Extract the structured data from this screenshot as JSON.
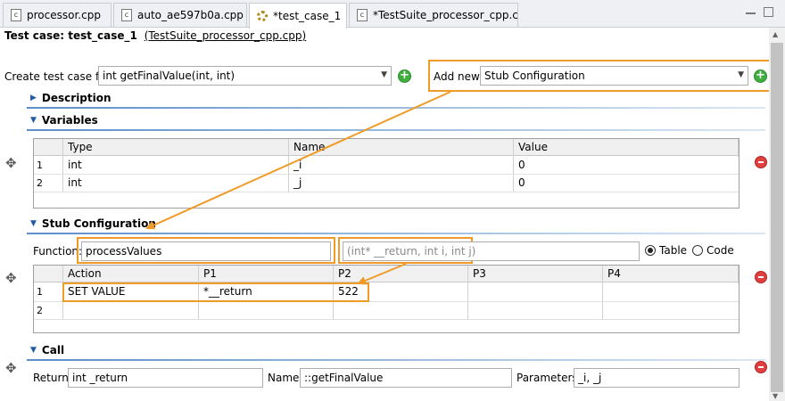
{
  "tabs": [
    {
      "label": "processor.cpp",
      "icon": "c-file-icon"
    },
    {
      "label": "auto_ae597b0a.cpp",
      "icon": "c-file-icon"
    },
    {
      "label": "*test_case_1",
      "icon": "gear-icon",
      "close": "×"
    },
    {
      "label": "*TestSuite_processor_cpp.cpp",
      "icon": "c-file-icon"
    }
  ],
  "file_icon_glyph": "c",
  "header": {
    "prefix": "Test case: test_case_1",
    "link": "(TestSuite_processor_cpp.cpp)"
  },
  "create": {
    "label": "Create test case for",
    "value": "int getFinalValue(int, int)"
  },
  "add_new": {
    "label": "Add new",
    "value": "Stub Configuration"
  },
  "sections": {
    "description": "Description",
    "variables": "Variables",
    "stub": "Stub Configuration",
    "call": "Call"
  },
  "variables": {
    "columns": [
      "Type",
      "Name",
      "Value"
    ],
    "rows": [
      {
        "num": "1",
        "type": "int",
        "name": "_i",
        "value": "0"
      },
      {
        "num": "2",
        "type": "int",
        "name": "_j",
        "value": "0"
      }
    ]
  },
  "stub": {
    "function_label": "Function:",
    "function_value": "processValues",
    "signature": "(int* __return, int i, int j)",
    "radio_table": "Table",
    "radio_code": "Code",
    "columns": [
      "Action",
      "P1",
      "P2",
      "P3",
      "P4"
    ],
    "rows": [
      {
        "num": "1",
        "action": "SET VALUE",
        "p1": "*__return",
        "p2": "522"
      },
      {
        "num": "2",
        "action": "",
        "p1": "",
        "p2": ""
      }
    ]
  },
  "call": {
    "return_label": "Return",
    "return_value": "int _return",
    "name_label": "Name",
    "name_value": "::getFinalValue",
    "params_label": "Parameters",
    "params_value": "_i, _j"
  },
  "colors": {
    "accent": "#f09a28",
    "section_line": "#5a8fc9",
    "add": "#3fae3f",
    "remove": "#e04040"
  }
}
